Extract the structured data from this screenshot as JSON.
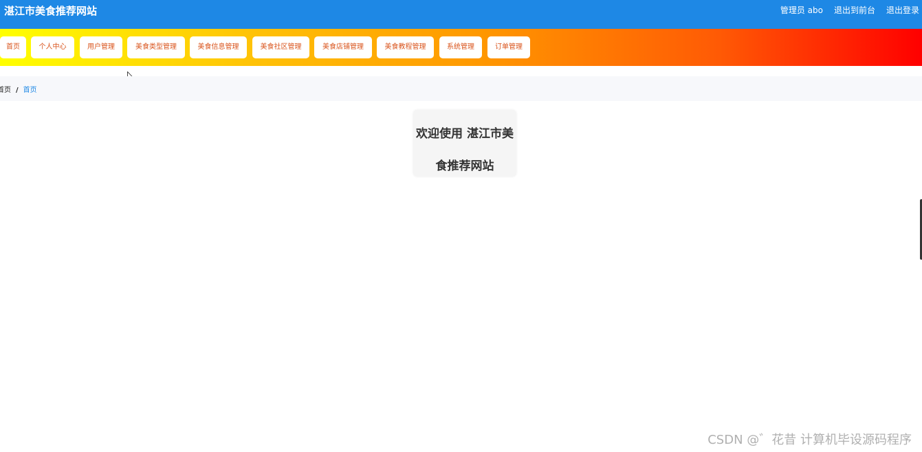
{
  "header": {
    "site_title": "湛江市美食推荐网站",
    "admin_label": "管理员 abo",
    "front_link": "退出到前台",
    "logout_link": "退出登录"
  },
  "nav": {
    "items": [
      {
        "label": "首页"
      },
      {
        "label": "个人中心"
      },
      {
        "label": "用户管理"
      },
      {
        "label": "美食类型管理"
      },
      {
        "label": "美食信息管理"
      },
      {
        "label": "美食社区管理"
      },
      {
        "label": "美食店铺管理"
      },
      {
        "label": "美食教程管理"
      },
      {
        "label": "系统管理"
      },
      {
        "label": "订单管理"
      }
    ]
  },
  "breadcrumb": {
    "home": "首页",
    "separator": "/",
    "current": "首页"
  },
  "main": {
    "welcome_text": "欢迎使用 湛江市美食推荐网站"
  },
  "watermark": "CSDN @゛花昔  计算机毕设源码程序",
  "colors": {
    "header_bg": "#1e88e5",
    "nav_text": "#d9541c",
    "breadcrumb_active": "#1e88e5"
  }
}
